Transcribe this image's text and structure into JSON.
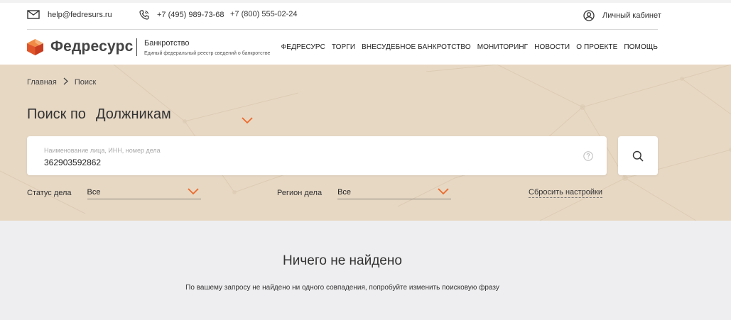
{
  "topbar": {
    "email": "help@fedresurs.ru",
    "phone_1": "+7 (495) 989-73-68",
    "phone_2": "+7 (800) 555-02-24",
    "cabinet": "Личный кабинет"
  },
  "header": {
    "logo": "Федресурс",
    "section_title": "Банкротство",
    "section_subtitle": "Единый федеральный реестр сведений о банкротстве",
    "nav": [
      "ФЕДРЕСУРС",
      "ТОРГИ",
      "ВНЕСУДЕБНОЕ БАНКРОТСТВО",
      "МОНИТОРИНГ",
      "НОВОСТИ",
      "О ПРОЕКТЕ",
      "ПОМОЩЬ"
    ]
  },
  "breadcrumb": {
    "home": "Главная",
    "current": "Поиск"
  },
  "search": {
    "title_prefix": "Поиск по",
    "category": "Должникам",
    "placeholder": "Наименование лица, ИНН, номер дела",
    "value": "362903592862"
  },
  "filters": {
    "status_label": "Статус дела",
    "status_value": "Все",
    "region_label": "Регион дела",
    "region_value": "Все",
    "reset": "Сбросить настройки"
  },
  "results": {
    "title": "Ничего не найдено",
    "message": "По вашему запросу не найдено ни одного совпадения, попробуйте изменить поисковую фразу"
  },
  "colors": {
    "accent": "#ec6a2b",
    "hero_bg": "#e7d8c4",
    "results_bg": "#eeeef0"
  }
}
